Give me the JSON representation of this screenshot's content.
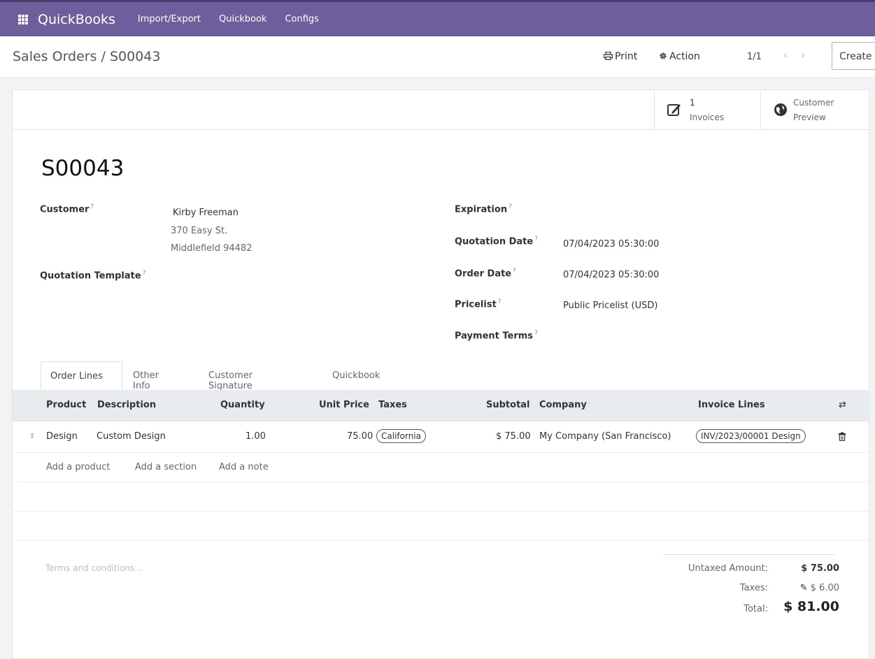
{
  "app": {
    "brand": "QuickBooks",
    "menu": [
      "Import/Export",
      "Quickbook",
      "Configs"
    ]
  },
  "control": {
    "breadcrumb": "Sales Orders / S00043",
    "print": "Print",
    "action": "Action",
    "pager": "1/1",
    "create": "Create"
  },
  "stats": {
    "invoices_count": "1",
    "invoices_label": "Invoices",
    "preview_line1": "Customer",
    "preview_line2": "Preview"
  },
  "order": {
    "name": "S00043",
    "customer_label": "Customer",
    "customer_name": "Kirby Freeman",
    "customer_street": "370 Easy St.",
    "customer_city": "Middlefield 94482",
    "template_label": "Quotation Template",
    "expiration_label": "Expiration",
    "quotation_date_label": "Quotation Date",
    "quotation_date": "07/04/2023 05:30:00",
    "order_date_label": "Order Date",
    "order_date": "07/04/2023 05:30:00",
    "pricelist_label": "Pricelist",
    "pricelist": "Public Pricelist (USD)",
    "payment_terms_label": "Payment Terms",
    "help_mark": "?"
  },
  "tabs": [
    "Order Lines",
    "Other Info",
    "Customer Signature",
    "Quickbook"
  ],
  "lines": {
    "headers": {
      "product": "Product",
      "description": "Description",
      "quantity": "Quantity",
      "unit_price": "Unit Price",
      "taxes": "Taxes",
      "subtotal": "Subtotal",
      "company": "Company",
      "invoice_lines": "Invoice Lines"
    },
    "rows": [
      {
        "product": "Design",
        "description": "Custom Design",
        "quantity": "1.00",
        "unit_price": "75.00",
        "taxes": "California",
        "subtotal": "$ 75.00",
        "company": "My Company (San Francisco)",
        "invoice_line": "INV/2023/00001 Design"
      }
    ],
    "add_product": "Add a product",
    "add_section": "Add a section",
    "add_note": "Add a note"
  },
  "notes_placeholder": "Terms and conditions...",
  "totals": {
    "untaxed_label": "Untaxed Amount:",
    "untaxed_value": "$ 75.00",
    "taxes_label": "Taxes:",
    "taxes_value": "$ 6.00",
    "total_label": "Total:",
    "total_value": "$ 81.00"
  },
  "colors": {
    "navbar": "#6f5e9c",
    "table_header": "#e9ecef"
  }
}
